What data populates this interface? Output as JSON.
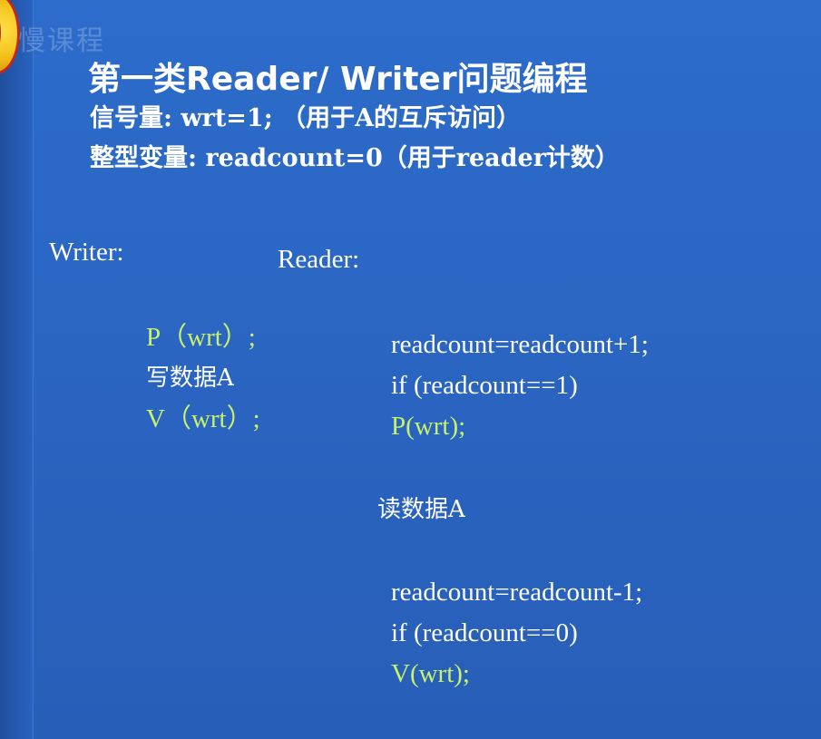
{
  "watermark": "慢课程",
  "title": "第一类Reader/ Writer问题编程",
  "semaphore_line": "信号量: wrt=1; （用于A的互斥访问）",
  "integer_line": "整型变量: readcount=0（用于reader计数）",
  "writer": {
    "label": "Writer:",
    "lines": [
      "P（wrt）;",
      "写数据A",
      "V（wrt）;"
    ]
  },
  "reader": {
    "label": "Reader:",
    "entry": [
      "readcount=readcount+1;",
      "if (readcount==1)",
      "P(wrt);"
    ],
    "read": "读数据A",
    "exit": [
      "readcount=readcount-1;",
      "if (readcount==0)",
      "V(wrt);"
    ]
  },
  "colors": {
    "background": "#2b67c4",
    "text": "#ffffff",
    "highlight": "#c8f26a"
  }
}
